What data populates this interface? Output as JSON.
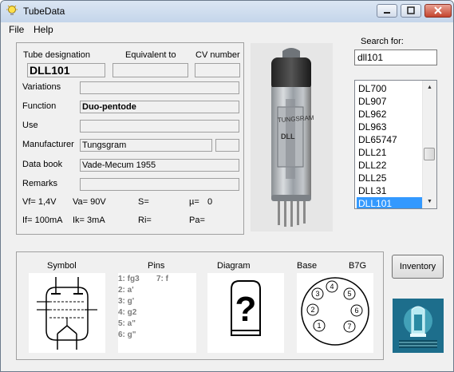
{
  "window": {
    "title": "TubeData"
  },
  "menu": [
    {
      "label": "File"
    },
    {
      "label": "Help"
    }
  ],
  "header": {
    "tube_designation_label": "Tube designation",
    "equivalent_label": "Equivalent to",
    "cv_label": "CV number",
    "tube_designation": "DLL101",
    "equivalent": "",
    "cv_number": ""
  },
  "details": {
    "variations_label": "Variations",
    "variations": "",
    "function_label": "Function",
    "function": "Duo-pentode",
    "use_label": "Use",
    "use": "",
    "manufacturer_label": "Manufacturer",
    "manufacturer": "Tungsgram",
    "manufacturer_code": "",
    "databook_label": "Data book",
    "databook": "Vade-Mecum 1955",
    "remarks_label": "Remarks",
    "remarks": ""
  },
  "specs": {
    "vf": "Vf= 1,4V",
    "va": "Va= 90V",
    "s": "S=",
    "mu": "µ=",
    "mu_value": "0",
    "if": "If= 100mA",
    "ik": "Ik= 3mA",
    "ri": "Ri=",
    "pa": "Pa="
  },
  "photo": {
    "text": "TUNGSRAM DLL101"
  },
  "search": {
    "label": "Search for:",
    "value": "dll101",
    "results": [
      "DL700",
      "DL907",
      "DL962",
      "DL963",
      "DL65747",
      "DLL21",
      "DLL22",
      "DLL25",
      "DLL31",
      "DLL101"
    ],
    "selected_index": 9
  },
  "bottom": {
    "symbol_label": "Symbol",
    "pins_label": "Pins",
    "diagram_label": "Diagram",
    "base_label": "Base",
    "base_type": "B7G",
    "pins_col1": [
      "1: fg3",
      "2: a'",
      "3: g'",
      "4: g2",
      "5: a\"",
      "6: g\""
    ],
    "pins_col2": [
      "7: f"
    ],
    "diagram_glyph": "?",
    "base_pins": [
      "1",
      "2",
      "3",
      "4",
      "5",
      "6",
      "7"
    ]
  },
  "buttons": {
    "inventory": "Inventory"
  },
  "colors": {
    "selection": "#3399ff",
    "logo": "#1d6e8c"
  }
}
